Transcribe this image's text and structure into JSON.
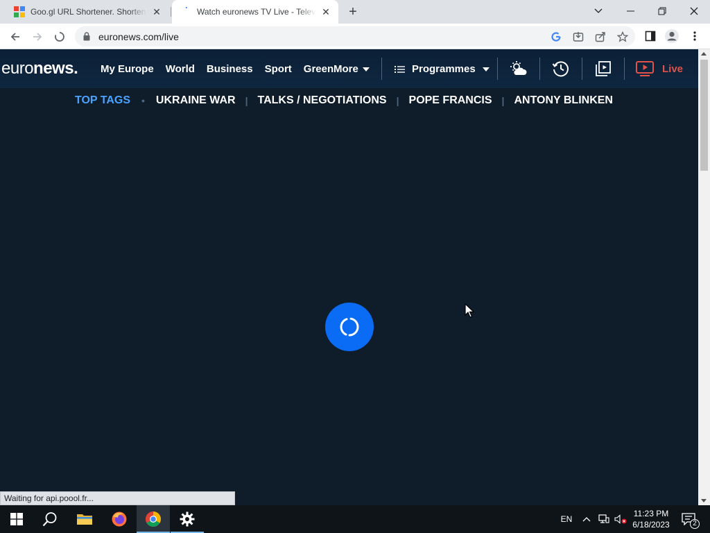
{
  "browser": {
    "tabs": [
      {
        "title": "Goo.gl URL Shortener. Shorten U",
        "favicon": "googl-icon",
        "active": false
      },
      {
        "title": "Watch euronews TV Live - Televis",
        "favicon": "loading-spinner-icon",
        "active": true
      }
    ],
    "new_tab": "+",
    "url": "euronews.com/live",
    "status_text": "Waiting for api.poool.fr..."
  },
  "site": {
    "logo_light": "euro",
    "logo_bold": "news.",
    "nav": [
      "My Europe",
      "World",
      "Business",
      "Sport",
      "Green"
    ],
    "more_label": "More",
    "programmes_label": "Programmes",
    "live_label": "Live",
    "tags": {
      "heading": "TOP TAGS",
      "items": [
        "UKRAINE WAR",
        "TALKS / NEGOTIATIONS",
        "POPE FRANCIS",
        "ANTONY BLINKEN"
      ]
    },
    "colors": {
      "accent_blue": "#0a6cf5",
      "live_red": "#e1524a",
      "tag_heading": "#4aa3ff",
      "background": "#0f1d2b"
    }
  },
  "taskbar": {
    "language": "EN",
    "time": "11:23 PM",
    "date": "6/18/2023",
    "notification_count": "2"
  }
}
